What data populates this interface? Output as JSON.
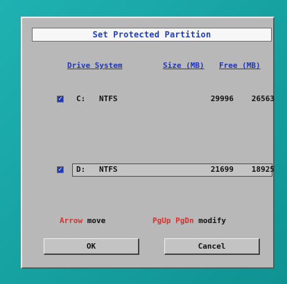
{
  "dialog": {
    "title": "Set Protected Partition",
    "headers": {
      "drive_system": "Drive System",
      "size_mb": "Size (MB)",
      "free_mb": "Free (MB)"
    },
    "rows": [
      {
        "checked": true,
        "drive": "C:",
        "system": "NTFS",
        "size": "29996",
        "free": "26563"
      },
      {
        "checked": true,
        "drive": "D:",
        "system": "NTFS",
        "size": "21699",
        "free": "18925"
      }
    ],
    "help": {
      "arrow_key": "Arrow",
      "arrow_text": "move",
      "page_keys": "PgUp PgDn",
      "page_text": "modify"
    },
    "buttons": {
      "ok": "OK",
      "cancel": "Cancel"
    },
    "checkbox_symbol": "✓",
    "colors": {
      "background": "#18a3a2",
      "panel": "#b8b8b8",
      "accent": "#1f3fbf",
      "key_color": "#d73131"
    }
  }
}
